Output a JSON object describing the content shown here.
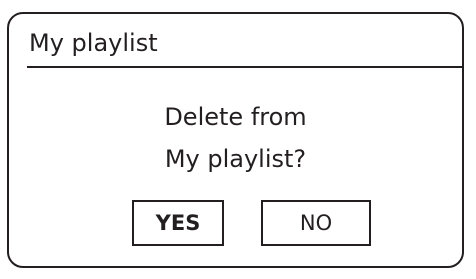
{
  "dialog": {
    "title": "My playlist",
    "message_line_1": "Delete from",
    "message_line_2": "My playlist?",
    "buttons": {
      "yes_label": "YES",
      "no_label": "NO",
      "selected": "YES"
    }
  },
  "colors": {
    "foreground": "#231f20",
    "background": "#ffffff"
  }
}
